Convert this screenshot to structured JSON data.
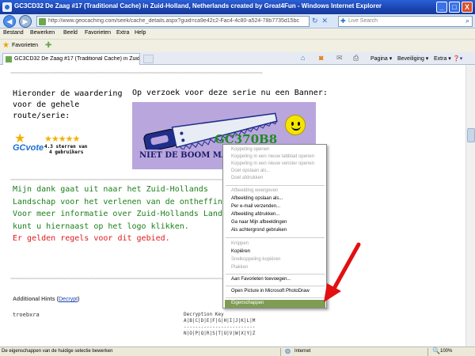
{
  "window": {
    "title": "GC3CD32 De Zaag #17 (Traditional Cache) in Zuid-Holland, Netherlands created by Great4Fun - Windows Internet Explorer",
    "minimize": "_",
    "maximize": "□",
    "close": "X"
  },
  "address": {
    "back": "◀",
    "forward": "▶",
    "url": "http://www.geocaching.com/seek/cache_details.aspx?guid=ca9e42c2-Fac4-4c80-a524-78b7735d15bc",
    "refresh": "↻",
    "stop": "✕",
    "search_placeholder": "Live Search",
    "search_glyph": "⌕",
    "live_glyph": "✚"
  },
  "menu": [
    "Bestand",
    "Bewerken",
    "Beeld",
    "Favorieten",
    "Extra",
    "Help"
  ],
  "favorites": {
    "label": "Favorieten",
    "star": "★",
    "add": "✚"
  },
  "tab": {
    "label": "GC3CD32 De Zaag #17 (Traditional Cache) in Zuid-Hol..."
  },
  "commands": {
    "home": "⌂",
    "feeds": "◙",
    "mail": "✉",
    "print": "⎙",
    "pagina": "Pagina ▾",
    "beveiliging": "Beveiliging ▾",
    "extra": "Extra ▾",
    "help": "❓▾"
  },
  "content": {
    "tilde_line": "~~~~~~~~~~~~~~~~~~~~~~~~~~~~~~~~~~~~~~~~~~~~~~~~~~~~~~~~~~~~~~~~~~~~~~~~~~~~~~~~~~~~~~~~~~~~~~~~~~~~~~~~~~",
    "rating_lines": [
      "Hieronder de waardering",
      "voor de gehele",
      "route/serie:"
    ],
    "gcvote": {
      "logo": "GCvote",
      "stars": "★★★★★",
      "line1": "4.3 sterren van",
      "line2": "4 gebruikers",
      "star": "★"
    },
    "banner_request": "Op verzoek voor deze serie nu een Banner:",
    "banner": {
      "code": "GC370B8",
      "slogan": "NIET DE BOOM MAAR"
    },
    "green_lines": [
      "Mijn dank gaat uit naar het Zuid-Hollands",
      "Landschap voor het verlenen van de ontheffing.",
      "Voor meer informatie over Zuid-Hollands Landsch",
      "kunt u hiernaast op het logo klikken."
    ],
    "red_line": "Er gelden regels voor dit gebied.",
    "hints_title": "Additional Hints (",
    "hints_decrypt": "Decrypt",
    "hints_close": ")",
    "hint_text": "troebxra",
    "decrypt_key": [
      "Decryption Key",
      "A|B|C|D|E|F|G|H|I|J|K|L|M",
      "-------------------------",
      "N|O|P|Q|R|S|T|U|V|W|X|Y|Z"
    ]
  },
  "context_menu": {
    "items": [
      {
        "label": "Koppeling openen",
        "enabled": false
      },
      {
        "label": "Koppeling in een nieuw tabblad openen",
        "enabled": false
      },
      {
        "label": "Koppeling in een nieuw venster openen",
        "enabled": false
      },
      {
        "label": "Doel opslaan als...",
        "enabled": false
      },
      {
        "label": "Doel afdrukken",
        "enabled": false
      },
      {
        "label": "Afbeelding weergeven",
        "enabled": false
      },
      {
        "label": "Afbeelding opslaan als...",
        "enabled": true
      },
      {
        "label": "Per e-mail verzenden...",
        "enabled": true
      },
      {
        "label": "Afbeelding afdrukken...",
        "enabled": true
      },
      {
        "label": "Ga naar Mijn afbeeldingen",
        "enabled": true
      },
      {
        "label": "Als achtergrond gebruiken",
        "enabled": true
      },
      {
        "label": "Knippen",
        "enabled": false
      },
      {
        "label": "Kopiëren",
        "enabled": true
      },
      {
        "label": "Snelkoppeling kopiëren",
        "enabled": false
      },
      {
        "label": "Plakken",
        "enabled": false
      },
      {
        "label": "Aan Favorieten toevoegen...",
        "enabled": true
      },
      {
        "label": "Open Picture in Microsoft PhotoDraw",
        "enabled": true
      },
      {
        "label": "Eigenschappen",
        "enabled": true,
        "selected": true
      }
    ],
    "highlight_color": "#7f9c54"
  },
  "status": {
    "text": "De eigenschappen van de huidige selectie bewerken",
    "zone": "Internet",
    "zoom": "100%",
    "globe": "◍",
    "zoom_icon": "🔍"
  },
  "colors": {
    "green_text": "#1a7f1a",
    "red_text": "#e01b1b",
    "arrow": "#e21010",
    "banner_bg": "#b9a6dd"
  }
}
